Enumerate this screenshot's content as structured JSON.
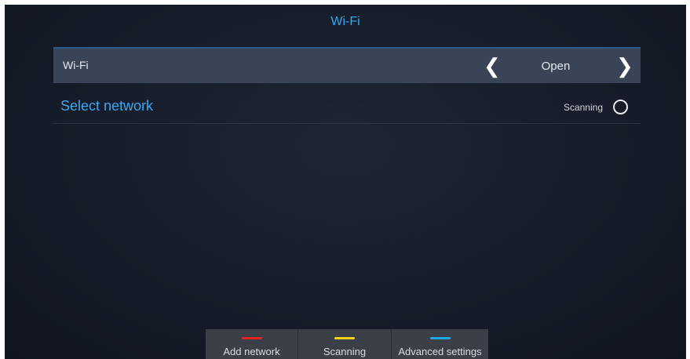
{
  "header": {
    "title": "Wi-Fi"
  },
  "wifi_row": {
    "label": "Wi-Fi",
    "prev_glyph": "❮",
    "value": "Open",
    "next_glyph": "❯"
  },
  "network_section": {
    "label": "Select network",
    "status": "Scanning",
    "status_icon": "loading-circle-icon"
  },
  "bottom_bar": {
    "buttons": [
      {
        "label": "Add network",
        "color": "#e02424"
      },
      {
        "label": "Scanning",
        "color": "#f5d214"
      },
      {
        "label": "Advanced settings",
        "color": "#20a8e6"
      }
    ]
  },
  "colors": {
    "accent": "#33a7ef",
    "background": "#161c29",
    "row_highlight": "#3a4457"
  }
}
